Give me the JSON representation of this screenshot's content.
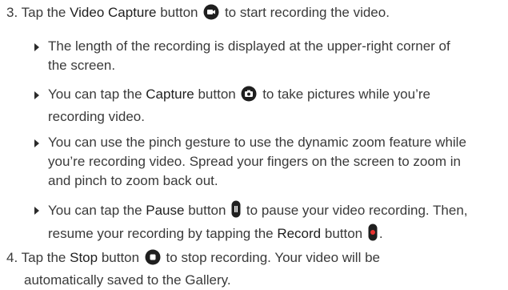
{
  "steps": [
    {
      "number": "3.",
      "pre": "Tap the ",
      "bold": "Video Capture",
      "mid": " button",
      "icon": "video-capture-icon",
      "post": " to start recording the video."
    },
    {
      "number": "4.",
      "pre": "Tap the ",
      "bold": "Stop",
      "mid": " button",
      "icon": "stop-icon",
      "post": " to stop recording. Your video will be",
      "line2": "automatically saved to the Gallery."
    }
  ],
  "bullets": [
    {
      "line1": "The length of the recording is displayed at the upper-right corner of",
      "line2": "the screen."
    },
    {
      "pre": "You can tap the ",
      "bold": "Capture",
      "mid": " button",
      "icon": "camera-capture-icon",
      "post": " to take pictures while you’re",
      "line2": "recording video."
    },
    {
      "line1": "You can use the pinch gesture to use the dynamic zoom feature while",
      "line2": "you’re recording video. Spread your fingers on the screen to zoom in",
      "line3": "and pinch to zoom back out."
    },
    {
      "pre": "You can tap the ",
      "bold": "Pause",
      "mid": " button",
      "icon": "pause-icon",
      "post": " to pause your video recording. Then,",
      "line2_pre": "resume your recording by tapping the ",
      "line2_bold": "Record",
      "line2_mid": " button",
      "line2_icon": "record-icon",
      "line2_post": "."
    }
  ],
  "colors": {
    "text": "#3a3a3a",
    "icon": "#1f1f1f",
    "record_red": "#e8312f"
  }
}
